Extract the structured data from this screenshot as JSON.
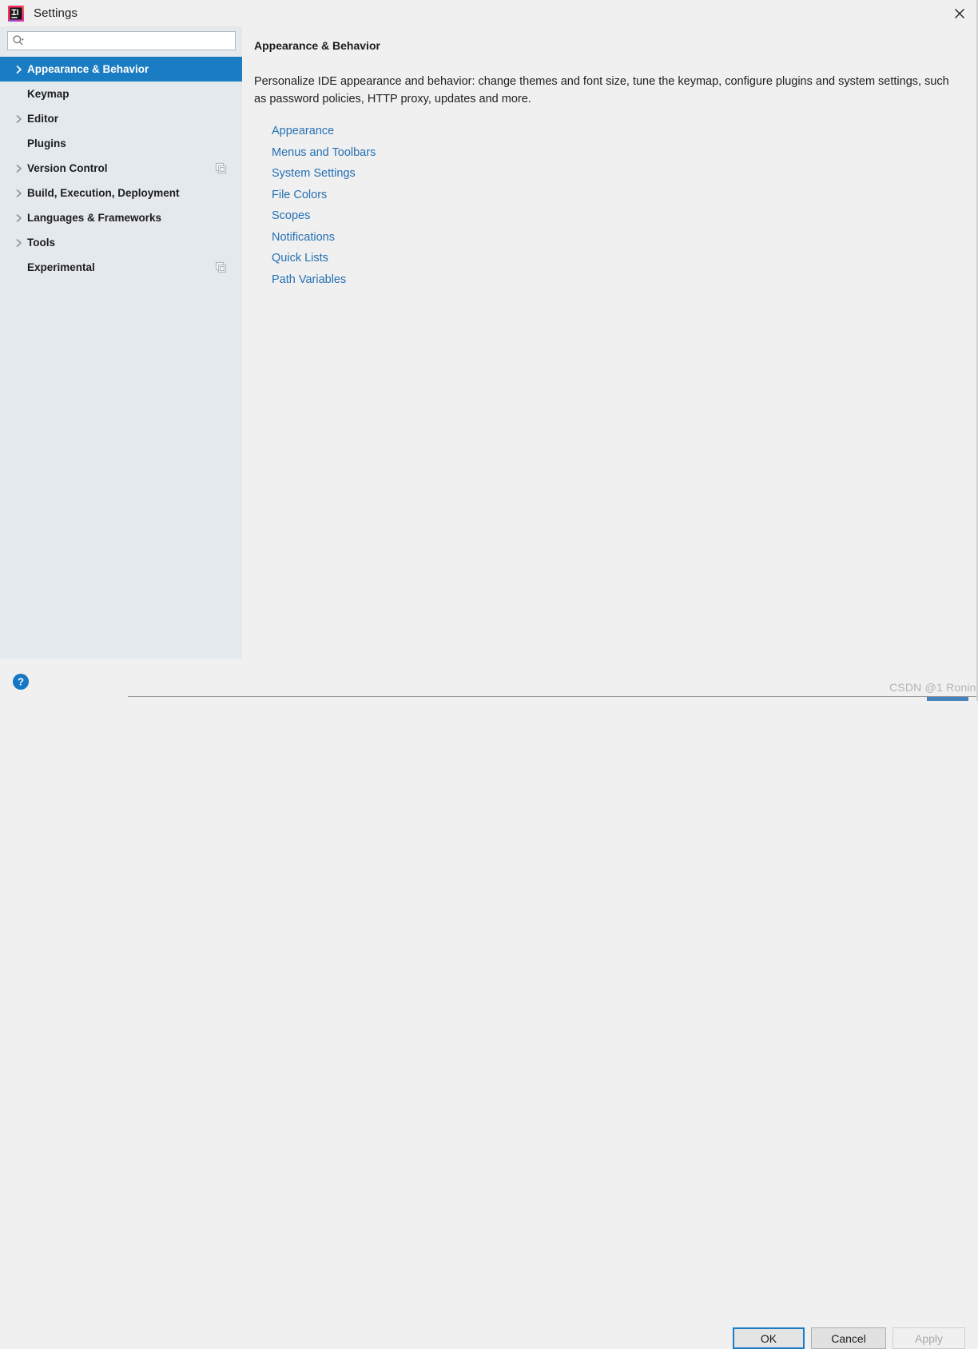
{
  "window": {
    "title": "Settings",
    "logo_icon": "intellij-idea-logo-icon",
    "close_icon": "close-icon"
  },
  "search": {
    "value": "",
    "placeholder": "",
    "icon": "search-icon",
    "dropdown_icon": "chevron-down-icon"
  },
  "sidebar": {
    "items": [
      {
        "label": "Appearance & Behavior",
        "expandable": true,
        "selected": true,
        "badge": false
      },
      {
        "label": "Keymap",
        "expandable": false,
        "selected": false,
        "badge": false
      },
      {
        "label": "Editor",
        "expandable": true,
        "selected": false,
        "badge": false
      },
      {
        "label": "Plugins",
        "expandable": false,
        "selected": false,
        "badge": false
      },
      {
        "label": "Version Control",
        "expandable": true,
        "selected": false,
        "badge": true
      },
      {
        "label": "Build, Execution, Deployment",
        "expandable": true,
        "selected": false,
        "badge": false
      },
      {
        "label": "Languages & Frameworks",
        "expandable": true,
        "selected": false,
        "badge": false
      },
      {
        "label": "Tools",
        "expandable": true,
        "selected": false,
        "badge": false
      },
      {
        "label": "Experimental",
        "expandable": false,
        "selected": false,
        "badge": true
      }
    ],
    "badge_icon": "copy-settings-icon",
    "chevron_icon": "chevron-right-icon"
  },
  "main": {
    "title": "Appearance & Behavior",
    "description": "Personalize IDE appearance and behavior: change themes and font size, tune the keymap, configure plugins and system settings, such as password policies, HTTP proxy, updates and more.",
    "links": [
      "Appearance",
      "Menus and Toolbars",
      "System Settings",
      "File Colors",
      "Scopes",
      "Notifications",
      "Quick Lists",
      "Path Variables"
    ]
  },
  "footer": {
    "help_icon": "help-question-icon",
    "ok_label": "OK",
    "cancel_label": "Cancel",
    "apply_label": "Apply",
    "apply_disabled": true
  },
  "watermark": {
    "text": "CSDN @1 Ronin"
  },
  "colors": {
    "selection_blue": "#1a7cc2",
    "link_blue": "#2470b3",
    "sidebar_bg": "#e4e9ed",
    "panel_bg": "#f0f0f0",
    "focus_border": "#1a7cc2",
    "disabled_text": "#a9a9a9"
  }
}
